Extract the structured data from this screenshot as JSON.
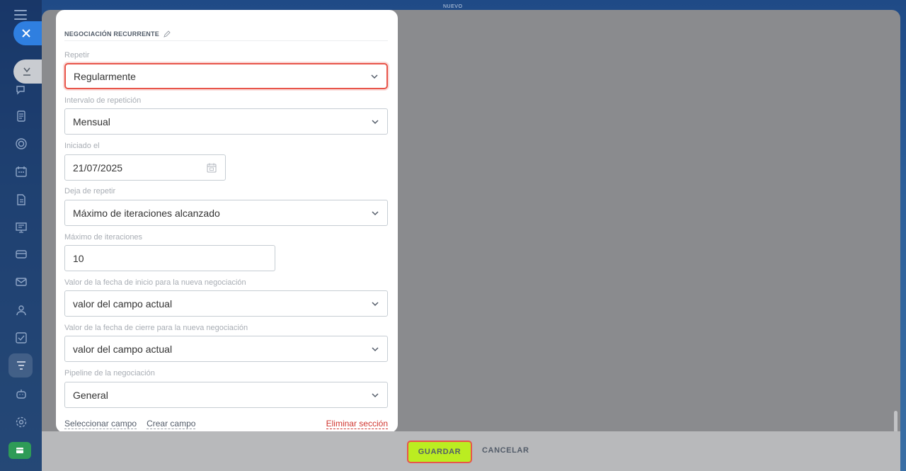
{
  "top": {
    "label": "NUEVO"
  },
  "panel": {
    "title": "NEGOCIACIÓN RECURRENTE",
    "fields": {
      "repeat": {
        "label": "Repetir",
        "value": "Regularmente"
      },
      "interval": {
        "label": "Intervalo de repetición",
        "value": "Mensual"
      },
      "started": {
        "label": "Iniciado el",
        "value": "21/07/2025"
      },
      "stop": {
        "label": "Deja de repetir",
        "value": "Máximo de iteraciones alcanzado"
      },
      "max_iter": {
        "label": "Máximo de iteraciones",
        "value": "10"
      },
      "start_date": {
        "label": "Valor de la fecha de inicio para la nueva negociación",
        "value": "valor del campo actual"
      },
      "close_date": {
        "label": "Valor de la fecha de cierre para la nueva negociación",
        "value": "valor del campo actual"
      },
      "pipeline": {
        "label": "Pipeline de la negociación",
        "value": "General"
      }
    },
    "links": {
      "select_field": "Seleccionar campo",
      "create_field": "Crear campo",
      "delete_section": "Eliminar sección"
    }
  },
  "footer": {
    "save": "GUARDAR",
    "cancel": "CANCELAR"
  },
  "colors": {
    "accent": "#2f7fe0",
    "save": "#bbed21",
    "highlight": "#e8554a",
    "danger": "#d0352f"
  },
  "sidebar_icons": [
    "menu-icon",
    "close-icon",
    "collapse-icon",
    "chat-icon",
    "tasks-icon",
    "target-icon",
    "calendar-icon",
    "document-icon",
    "board-icon",
    "card-icon",
    "mail-icon",
    "contacts-icon",
    "checkbox-icon",
    "filter-icon",
    "robot-icon",
    "settings-icon",
    "store-icon"
  ]
}
